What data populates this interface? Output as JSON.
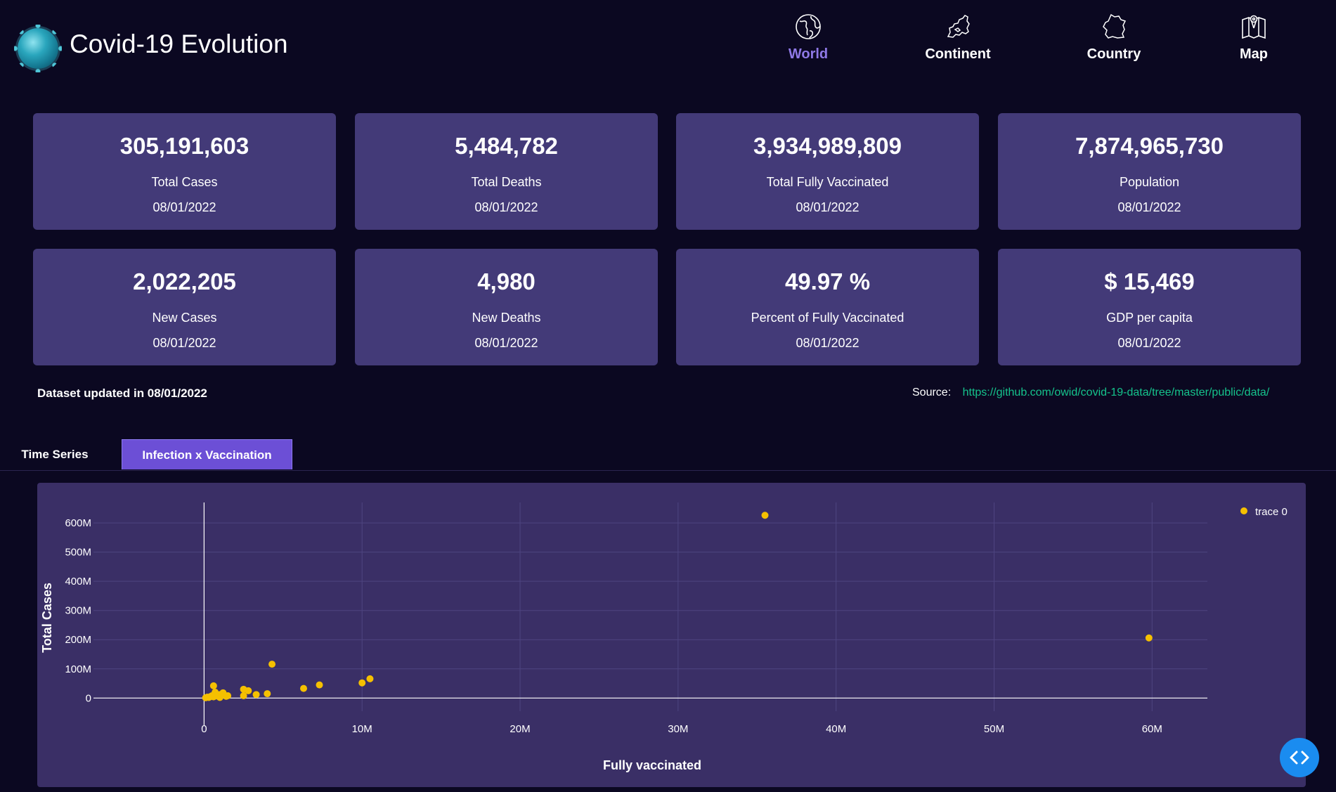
{
  "header": {
    "title": "Covid-19 Evolution",
    "nav": [
      {
        "label": "World",
        "icon": "globe-icon",
        "active": true
      },
      {
        "label": "Continent",
        "icon": "europe-map-icon",
        "active": false
      },
      {
        "label": "Country",
        "icon": "country-outline-icon",
        "active": false
      },
      {
        "label": "Map",
        "icon": "folded-map-icon",
        "active": false
      }
    ]
  },
  "cards": [
    {
      "value": "305,191,603",
      "label": "Total Cases",
      "date": "08/01/2022"
    },
    {
      "value": "5,484,782",
      "label": "Total Deaths",
      "date": "08/01/2022"
    },
    {
      "value": "3,934,989,809",
      "label": "Total Fully Vaccinated",
      "date": "08/01/2022"
    },
    {
      "value": "7,874,965,730",
      "label": "Population",
      "date": "08/01/2022"
    },
    {
      "value": "2,022,205",
      "label": "New Cases",
      "date": "08/01/2022"
    },
    {
      "value": "4,980",
      "label": "New Deaths",
      "date": "08/01/2022"
    },
    {
      "value": "49.97 %",
      "label": "Percent of Fully Vaccinated",
      "date": "08/01/2022"
    },
    {
      "value": "$ 15,469",
      "label": "GDP per capita",
      "date": "08/01/2022"
    }
  ],
  "footer_info": {
    "updated": "Dataset updated in 08/01/2022",
    "source_label": "Source:",
    "source_url": "https://github.com/owid/covid-19-data/tree/master/public/data/"
  },
  "tabs": [
    {
      "label": "Time Series",
      "active": false
    },
    {
      "label": "Infection x Vaccination",
      "active": true
    }
  ],
  "colors": {
    "background": "#0b0821",
    "card": "#433a78",
    "chart_panel": "#3a2f66",
    "accent": "#8f79e6",
    "tab_active": "#6c4fd6",
    "marker": "#f5c000",
    "link": "#15c38c"
  },
  "chart_data": {
    "type": "scatter",
    "xlabel": "Fully vaccinated",
    "ylabel": "Total Cases",
    "xlim": [
      -7000000,
      63500000
    ],
    "ylim": [
      -45000000,
      670000000
    ],
    "xticks": [
      0,
      10000000,
      20000000,
      30000000,
      40000000,
      50000000,
      60000000
    ],
    "xtick_labels": [
      "0",
      "10M",
      "20M",
      "30M",
      "40M",
      "50M",
      "60M"
    ],
    "yticks": [
      0,
      100000000,
      200000000,
      300000000,
      400000000,
      500000000,
      600000000
    ],
    "ytick_labels": [
      "0",
      "100M",
      "200M",
      "300M",
      "400M",
      "500M",
      "600M"
    ],
    "grid": true,
    "legend_position": "top-right",
    "series": [
      {
        "name": "trace 0",
        "color": "#f5c000",
        "x": [
          100000,
          200000,
          300000,
          400000,
          500000,
          600000,
          700000,
          800000,
          900000,
          1000000,
          1200000,
          1400000,
          1500000,
          600000,
          700000,
          1000000,
          2500000,
          2800000,
          3300000,
          4000000,
          2500000,
          4300000,
          6300000,
          7300000,
          10000000,
          10500000,
          35500000,
          59800000
        ],
        "y": [
          1000000,
          3000000,
          2000000,
          5000000,
          8000000,
          4000000,
          20000000,
          10000000,
          6000000,
          2000000,
          18000000,
          6000000,
          8000000,
          42000000,
          15000000,
          12000000,
          30000000,
          25000000,
          12000000,
          15000000,
          8000000,
          116000000,
          33000000,
          45000000,
          52000000,
          66000000,
          626000000,
          206000000
        ]
      }
    ]
  }
}
